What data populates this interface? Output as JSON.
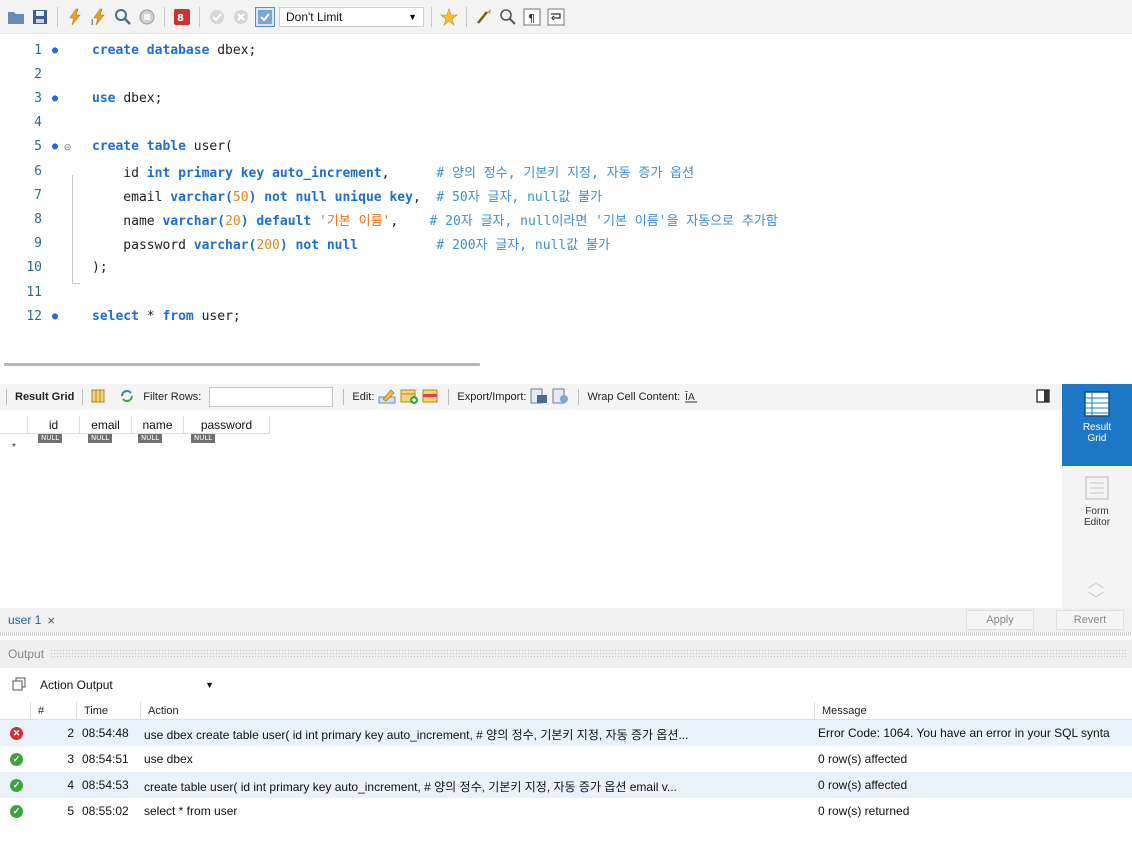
{
  "toolbar": {
    "limit_value": "Don't Limit",
    "icons": [
      "folder-icon",
      "save-icon",
      "execute-icon",
      "execute-current-icon",
      "explain-icon",
      "stop-icon",
      "toggle-output-icon",
      "commit-icon",
      "rollback-icon",
      "autocommit-icon",
      "beautify-icon",
      "brush-icon",
      "find-icon",
      "invisible-chars-icon",
      "wrap-icon"
    ]
  },
  "editor": {
    "lines": [
      {
        "n": "1",
        "dot": true,
        "code": [
          [
            "kw",
            "create database "
          ],
          [
            "id",
            "dbex;"
          ]
        ]
      },
      {
        "n": "2",
        "dot": false,
        "code": []
      },
      {
        "n": "3",
        "dot": true,
        "code": [
          [
            "kw",
            "use "
          ],
          [
            "id",
            "dbex;"
          ]
        ]
      },
      {
        "n": "4",
        "dot": false,
        "code": []
      },
      {
        "n": "5",
        "dot": true,
        "fold": true,
        "code": [
          [
            "kw",
            "create table "
          ],
          [
            "id",
            "user("
          ]
        ]
      },
      {
        "n": "6",
        "dot": false,
        "code": [
          [
            "id",
            "    id "
          ],
          [
            "kw",
            "int primary key auto_increment"
          ],
          [
            "id",
            ",      "
          ],
          [
            "cm",
            "# 양의 정수, 기본키 지정, 자동 증가 옵션"
          ]
        ]
      },
      {
        "n": "7",
        "dot": false,
        "code": [
          [
            "id",
            "    email "
          ],
          [
            "kw",
            "varchar("
          ],
          [
            "num",
            "50"
          ],
          [
            "kw",
            ") not null unique key"
          ],
          [
            "id",
            ",  "
          ],
          [
            "cm",
            "# 50자 글자, null값 불가"
          ]
        ]
      },
      {
        "n": "8",
        "dot": false,
        "code": [
          [
            "id",
            "    name "
          ],
          [
            "kw",
            "varchar("
          ],
          [
            "num",
            "20"
          ],
          [
            "kw",
            ") default "
          ],
          [
            "str",
            "'기본 이름'"
          ],
          [
            "id",
            ",    "
          ],
          [
            "cm",
            "# 20자 글자, null이라면 '기본 이름'을 자동으로 추가함"
          ]
        ]
      },
      {
        "n": "9",
        "dot": false,
        "code": [
          [
            "id",
            "    password "
          ],
          [
            "kw",
            "varchar("
          ],
          [
            "num",
            "200"
          ],
          [
            "kw",
            ") not null"
          ],
          [
            "id",
            "          "
          ],
          [
            "cm",
            "# 200자 글자, null값 불가"
          ]
        ]
      },
      {
        "n": "10",
        "dot": false,
        "code": [
          [
            "id",
            ");"
          ]
        ]
      },
      {
        "n": "11",
        "dot": false,
        "code": []
      },
      {
        "n": "12",
        "dot": true,
        "code": [
          [
            "kw",
            "select "
          ],
          [
            "id",
            "* "
          ],
          [
            "kw",
            "from "
          ],
          [
            "id",
            "user;"
          ]
        ]
      }
    ]
  },
  "result": {
    "grid_label": "Result Grid",
    "filter_label": "Filter Rows:",
    "edit_label": "Edit:",
    "export_label": "Export/Import:",
    "wrap_label": "Wrap Cell Content:",
    "columns": [
      "id",
      "email",
      "name",
      "password"
    ],
    "null_text": "NULL",
    "row_marker": "*"
  },
  "side": {
    "result_grid_label": "Result\nGrid",
    "form_editor_label": "Form\nEditor"
  },
  "tab": {
    "label": "user 1",
    "close": "×",
    "apply": "Apply",
    "revert": "Revert"
  },
  "output": {
    "title": "Output",
    "select_value": "Action Output",
    "headers": {
      "num": "#",
      "time": "Time",
      "action": "Action",
      "message": "Message"
    },
    "rows": [
      {
        "status": "error",
        "num": "2",
        "time": "08:54:48",
        "action": "use dbex  create table user(    id int primary key auto_increment,      # 양의 정수, 기본키 지정, 자동 증가 옵션...",
        "message": "Error Code: 1064. You have an error in your SQL synta"
      },
      {
        "status": "ok",
        "num": "3",
        "time": "08:54:51",
        "action": "use dbex",
        "message": "0 row(s) affected"
      },
      {
        "status": "ok",
        "num": "4",
        "time": "08:54:53",
        "action": "create table user(    id int primary key auto_increment,      # 양의 정수, 기본키 지정, 자동 증가 옵션    email v...",
        "message": "0 row(s) affected"
      },
      {
        "status": "ok",
        "num": "5",
        "time": "08:55:02",
        "action": "select * from user",
        "message": "0 row(s) returned"
      }
    ]
  },
  "colors": {
    "accent": "#1c78c7",
    "keyword": "#1a6fd0",
    "comment": "#3a8fd6",
    "string": "#e6701c",
    "number": "#d88a1e",
    "error": "#cf3030",
    "ok": "#3aa53a"
  }
}
